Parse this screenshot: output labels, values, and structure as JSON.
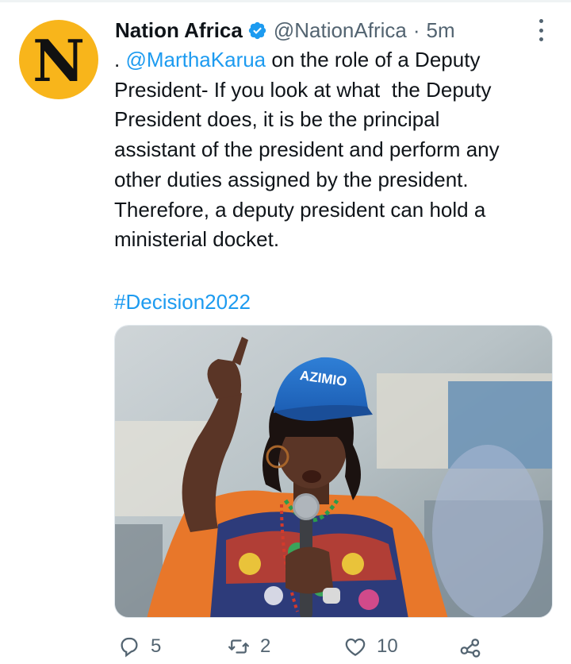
{
  "tweet": {
    "author_name": "Nation Africa",
    "avatar_letter": "N",
    "handle": "@NationAfrica",
    "separator": "·",
    "time": "5m",
    "text_prefix": ". ",
    "mention": "@MarthaKarua",
    "text_rest": " on the role of a Deputy\nPresident- If you look at what  the Deputy\nPresident does, it is be the principal\nassistant of the president and perform any\nother duties assigned by the president.\nTherefore, a deputy president can hold a\nministerial docket.",
    "hashtag": "#Decision2022",
    "media": {
      "cap_text": "AZIMIO"
    }
  },
  "actions": {
    "reply_count": "5",
    "retweet_count": "2",
    "like_count": "10"
  },
  "colors": {
    "accent": "#1d9bf0",
    "avatar_bg": "#f8b51b",
    "secondary_text": "#536471"
  },
  "icons": [
    "verified-badge-icon",
    "more-options-icon",
    "reply-icon",
    "retweet-icon",
    "like-icon",
    "share-icon"
  ]
}
